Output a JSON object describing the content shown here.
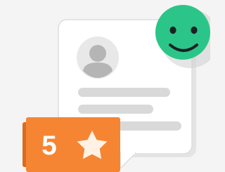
{
  "review": {
    "rating": "5",
    "rating_scale": "stars",
    "sentiment": "positive"
  },
  "icons": {
    "avatar": "user-avatar-icon",
    "star": "star-icon",
    "smiley": "smiley-face-icon"
  },
  "colors": {
    "background": "#f4f4f4",
    "card": "#ffffff",
    "card_border": "#dddddd",
    "placeholder": "#d9d9d9",
    "avatar_bg": "#e8e8e8",
    "avatar_fg": "#b5b5b5",
    "rating_badge": "#f58533",
    "rating_badge_dark": "#d96c1f",
    "star": "#fff2e5",
    "smiley": "#2bc589",
    "smiley_shadow": "#cfcfcf",
    "smiley_feature": "#1a2222"
  }
}
